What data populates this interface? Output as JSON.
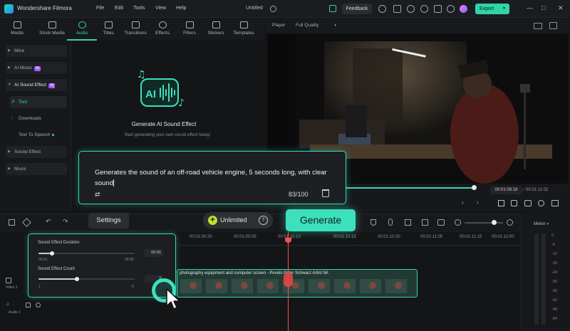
{
  "titlebar": {
    "app_name": "Wondershare Filmora",
    "menu": [
      "File",
      "Edit",
      "Tools",
      "View",
      "Help"
    ],
    "document": "Untitled",
    "feedback": "Feedback",
    "export": "Export"
  },
  "toolbar": {
    "tabs": [
      "Media",
      "Stock Media",
      "Audio",
      "Titles",
      "Transitions",
      "Effects",
      "Filters",
      "Stickers",
      "Templates"
    ],
    "active": "Audio"
  },
  "sidebar": {
    "items": [
      {
        "label": "Mine"
      },
      {
        "label": "AI Music",
        "tag": "AI"
      },
      {
        "label": "AI Sound Effect",
        "tag": "AI"
      },
      {
        "label": "Tool"
      },
      {
        "label": "Downloads"
      },
      {
        "label": "Text To Speech"
      },
      {
        "label": "Sound Effect"
      },
      {
        "label": "Music"
      }
    ]
  },
  "library": {
    "badge": "AI",
    "title": "Generate AI Sound Effect",
    "subtitle": "Start generating your own sound effect today!"
  },
  "player": {
    "label": "Player",
    "quality": "Full Quality",
    "current_time": "00:01:09:18",
    "total_time": "00:01:11:02"
  },
  "timeline": {
    "ruler": [
      "00:01:00:20",
      "00:01:05:05",
      "00:01:10:10",
      "00:01:10:15",
      "00:01:10:20",
      "00:01:11:05",
      "00:01:11:15",
      "00:01:12:00"
    ],
    "clip_name": "photography equipment and computer screen - Pexels Peter Schwarz Artist 5K",
    "track_video": "Video 1",
    "track_audio": "Audio 1"
  },
  "meter": {
    "label": "Meter",
    "levels": [
      "0",
      "-6",
      "-12",
      "-18",
      "-24",
      "-30",
      "-36",
      "-42",
      "-48",
      "-54"
    ]
  },
  "prompt": {
    "text": "Generates the sound of an off-road vehicle engine, 5 seconds long, with clear sound",
    "counter": "83/100",
    "settings": "Settings",
    "unlimited": "Unlimited",
    "generate": "Generate"
  },
  "sound_effect_settings": {
    "duration_label": "Sound Effect Duration",
    "duration_value": "00:05",
    "duration_min": "00:01",
    "duration_max": "00:30",
    "duration_fraction": 0.14,
    "count_label": "Sound Effect Count",
    "count_value": "3",
    "count_min": "1",
    "count_max": "6",
    "count_fraction": 0.4
  },
  "colors": {
    "accent": "#3ce0bc",
    "playhead": "#ff4d4d",
    "ai_tag": "#8a5bff"
  }
}
